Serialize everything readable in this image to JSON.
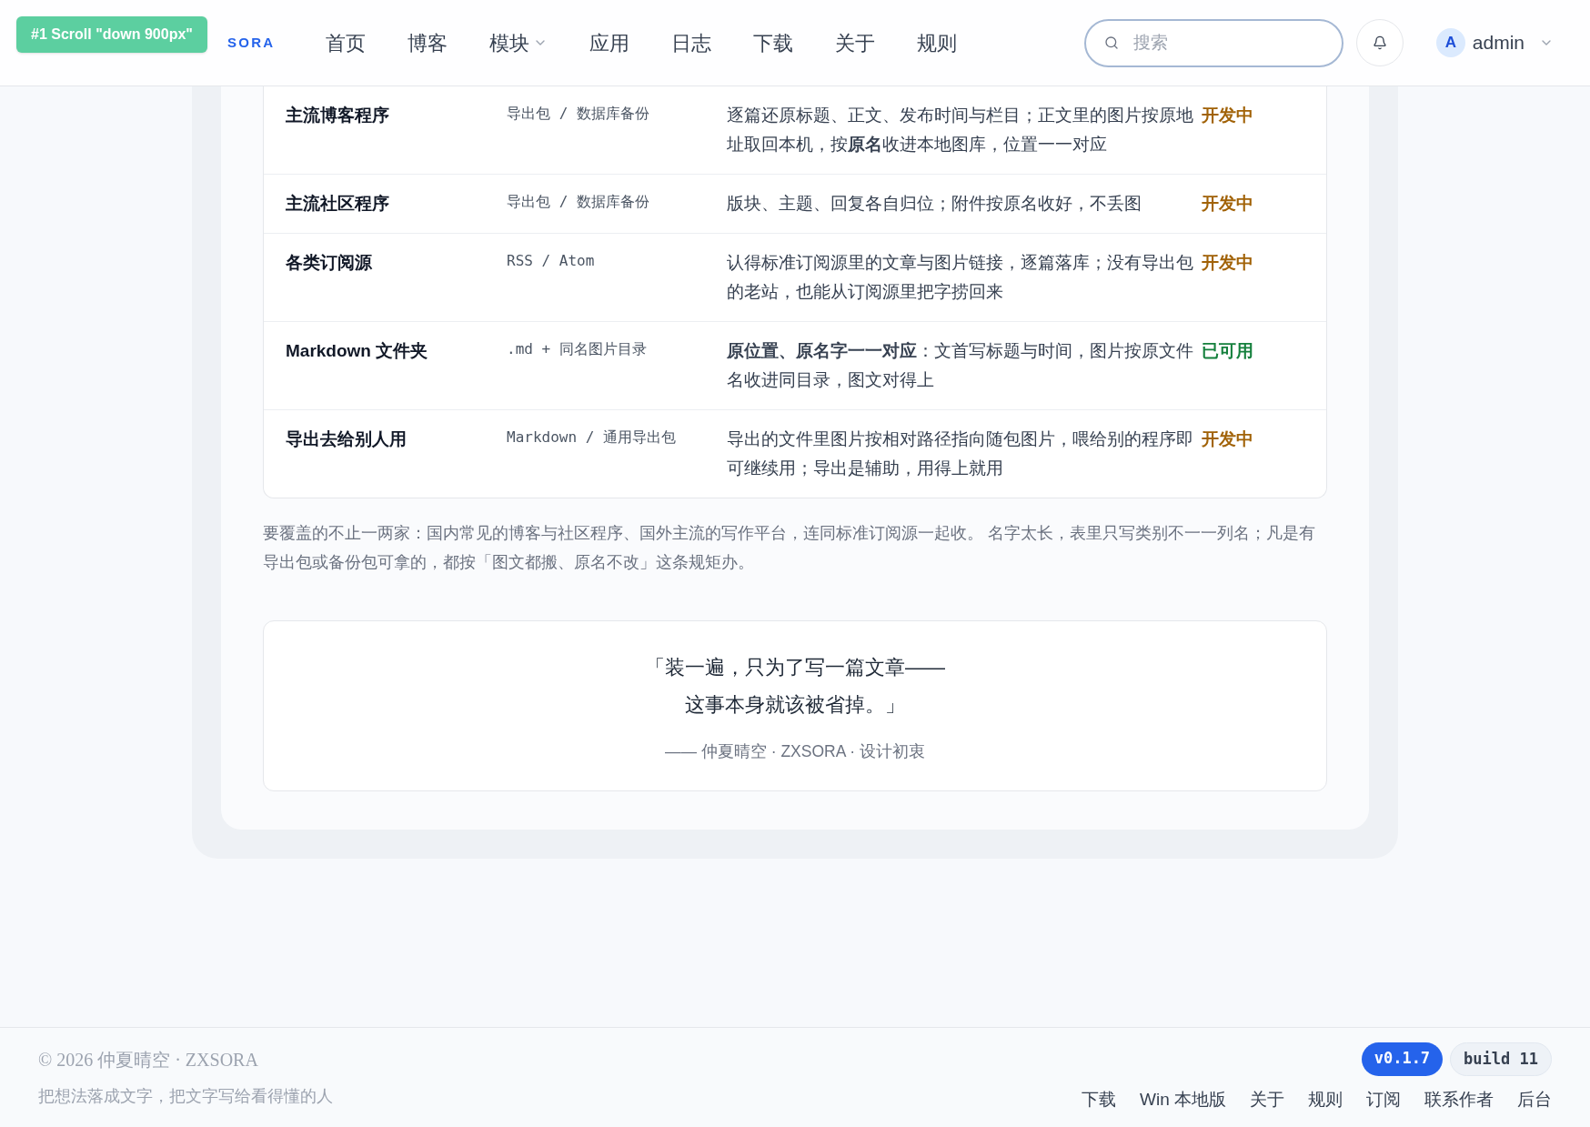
{
  "overlay_badge": "#1 Scroll \"down 900px\"",
  "header": {
    "logo": "SORA",
    "nav": [
      {
        "label": "首页",
        "dropdown": false
      },
      {
        "label": "博客",
        "dropdown": false
      },
      {
        "label": "模块",
        "dropdown": true
      },
      {
        "label": "应用",
        "dropdown": false
      },
      {
        "label": "日志",
        "dropdown": false
      },
      {
        "label": "下载",
        "dropdown": false
      },
      {
        "label": "关于",
        "dropdown": false
      },
      {
        "label": "规则",
        "dropdown": false
      }
    ],
    "search": {
      "placeholder": "搜索"
    },
    "user": {
      "avatar": "A",
      "name": "admin"
    }
  },
  "table": {
    "rows": [
      {
        "name": "主流博客程序",
        "format": "导出包 / 数据库备份",
        "description": "逐篇还原标题、正文、发布时间与栏目；正文里的图片按原地址取回本机，按**原名**收进本地图库，位置一一对应",
        "status": {
          "text": "开发中",
          "kind": "dev"
        }
      },
      {
        "name": "主流社区程序",
        "format": "导出包 / 数据库备份",
        "description": "版块、主题、回复各自归位；附件按原名收好，不丢图",
        "status": {
          "text": "开发中",
          "kind": "dev"
        }
      },
      {
        "name": "各类订阅源",
        "format": "RSS / Atom",
        "description": "认得标准订阅源里的文章与图片链接，逐篇落库；没有导出包的老站，也能从订阅源里把字捞回来",
        "status": {
          "text": "开发中",
          "kind": "dev"
        }
      },
      {
        "name": "Markdown 文件夹",
        "format": ".md + 同名图片目录",
        "description": "**原位置、原名字一一对应**：文首写标题与时间，图片按原文件名收进同目录，图文对得上",
        "status": {
          "text": "已可用",
          "kind": "ready"
        }
      },
      {
        "name": "导出去给别人用",
        "format": "Markdown / 通用导出包",
        "description": "导出的文件里图片按相对路径指向随包图片，喂给别的程序即可继续用；导出是辅助，用得上就用",
        "status": {
          "text": "开发中",
          "kind": "dev"
        }
      }
    ]
  },
  "note": "要覆盖的不止一两家：国内常见的博客与社区程序、国外主流的写作平台，连同标准订阅源一起收。 名字太长，表里只写类别不一一列名；凡是有导出包或备份包可拿的，都按「图文都搬、原名不改」这条规矩办。",
  "quote": {
    "lines": [
      "「装一遍，只为了写一篇文章——",
      "这事本身就该被省掉。」"
    ],
    "attribution": "—— 仲夏晴空 · ZXSORA · 设计初衷"
  },
  "footer": {
    "copyright": "© 2026 仲夏晴空 · ZXSORA",
    "tagline": "把想法落成文字，把文字写给看得懂的人",
    "version": "v0.1.7",
    "build": "build 11",
    "links": [
      "下载",
      "Win 本地版",
      "关于",
      "规则",
      "订阅",
      "联系作者",
      "后台"
    ]
  }
}
